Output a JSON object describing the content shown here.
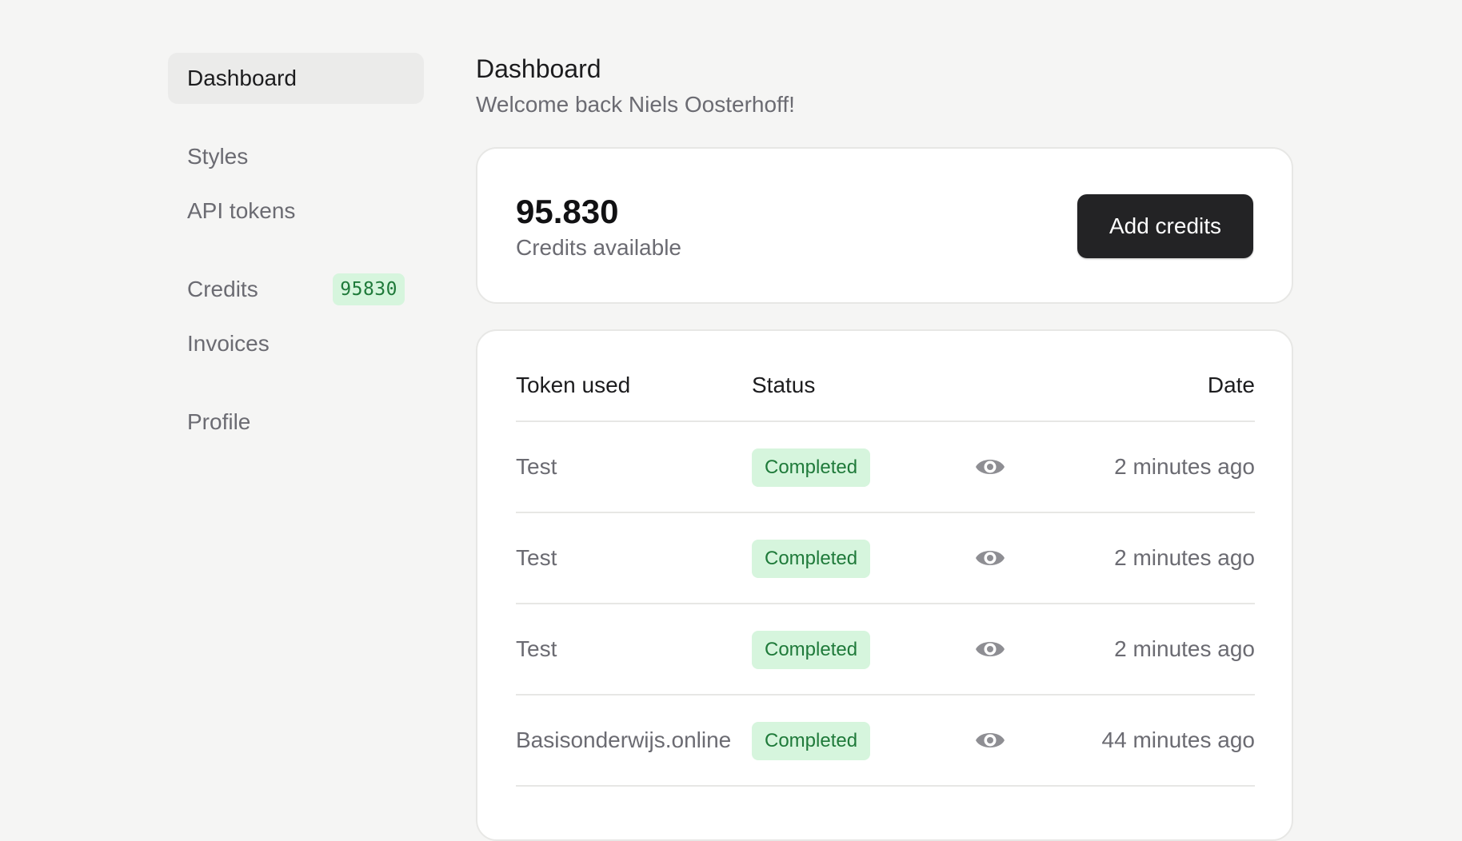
{
  "sidebar": {
    "items": [
      {
        "label": "Dashboard",
        "active": true
      },
      {
        "label": "Styles"
      },
      {
        "label": "API tokens"
      },
      {
        "label": "Credits",
        "badge": "95830"
      },
      {
        "label": "Invoices"
      },
      {
        "label": "Profile"
      }
    ]
  },
  "header": {
    "title": "Dashboard",
    "subtitle": "Welcome back Niels Oosterhoff!"
  },
  "credits": {
    "value": "95.830",
    "label": "Credits available",
    "button_label": "Add credits"
  },
  "table": {
    "headers": {
      "token": "Token used",
      "status": "Status",
      "date": "Date"
    },
    "rows": [
      {
        "token": "Test",
        "status": "Completed",
        "action_icon": "eye-icon",
        "date": "2 minutes ago"
      },
      {
        "token": "Test",
        "status": "Completed",
        "action_icon": "eye-icon",
        "date": "2 minutes ago"
      },
      {
        "token": "Test",
        "status": "Completed",
        "action_icon": "eye-icon",
        "date": "2 minutes ago"
      },
      {
        "token": "Basisonderwijs.online",
        "status": "Completed",
        "action_icon": "eye-icon",
        "date": "44 minutes ago"
      }
    ]
  },
  "colors": {
    "background": "#f5f5f4",
    "badge_bg": "#d6f5dd",
    "badge_text": "#1f7a3a",
    "primary_button": "#232325"
  }
}
